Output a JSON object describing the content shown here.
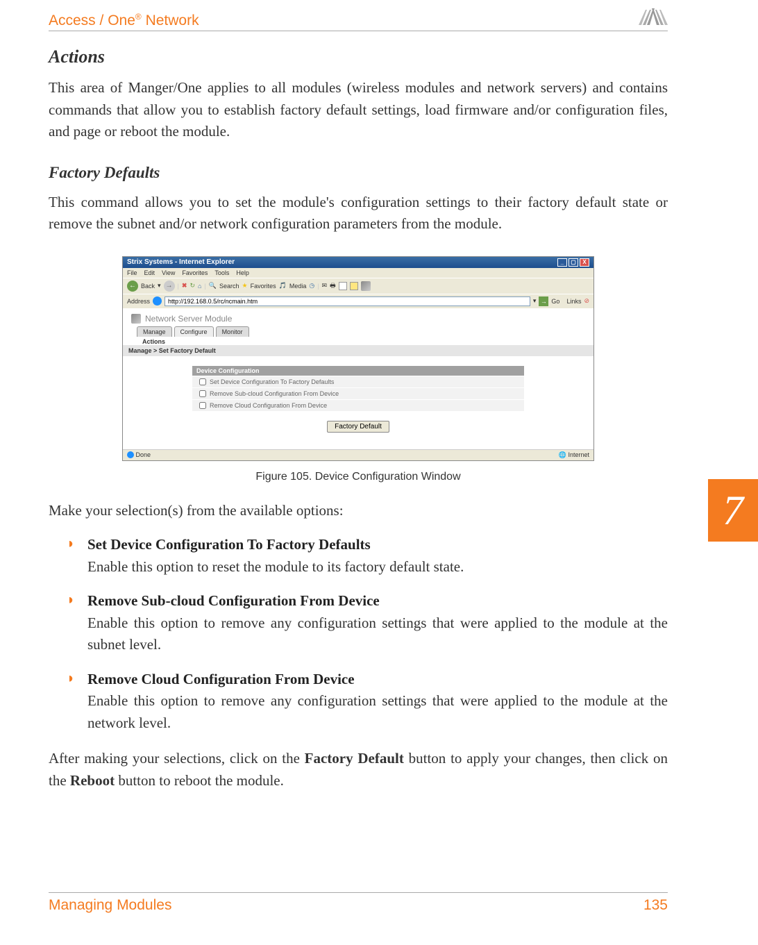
{
  "header": {
    "brand_prefix": "Access / One",
    "brand_suffix": " Network"
  },
  "sections": {
    "actions_title": "Actions",
    "actions_para": "This area of Manger/One applies to all modules (wireless modules and network servers) and contains commands that allow you to establish factory default settings, load firmware and/or configuration files, and page or reboot the module.",
    "factory_title": "Factory Defaults",
    "factory_para": "This command allows you to set the module's configuration settings to their factory default state or remove the subnet and/or network configuration parameters from the module."
  },
  "screenshot": {
    "window_title": "Strix Systems - Internet Explorer",
    "menu": {
      "file": "File",
      "edit": "Edit",
      "view": "View",
      "favorites": "Favorites",
      "tools": "Tools",
      "help": "Help"
    },
    "toolbar": {
      "back": "Back",
      "search": "Search",
      "favorites": "Favorites",
      "media": "Media"
    },
    "address_label": "Address",
    "url": "http://192.168.0.5/rc/ncmain.htm",
    "go": "Go",
    "links": "Links",
    "module_title": "Network Server Module",
    "tabs": {
      "manage": "Manage",
      "configure": "Configure",
      "monitor": "Monitor"
    },
    "actions_label": "Actions",
    "breadcrumb": "Manage > Set Factory Default",
    "config_header": "Device Configuration",
    "opt1": "Set Device Configuration To Factory Defaults",
    "opt2": "Remove Sub-cloud Configuration From Device",
    "opt3": "Remove Cloud Configuration From Device",
    "button": "Factory Default",
    "status_done": "Done",
    "status_internet": "Internet"
  },
  "figure_caption": "Figure 105. Device Configuration Window",
  "post_figure_para": "Make your selection(s) from the available options:",
  "options": {
    "opt1_title": "Set Device Configuration To Factory Defaults",
    "opt1_desc": "Enable this option to reset the module to its factory default state.",
    "opt2_title": "Remove Sub-cloud Configuration From Device",
    "opt2_desc": "Enable this option to remove any configuration settings that were applied to the module at the subnet level.",
    "opt3_title": "Remove Cloud Configuration From Device",
    "opt3_desc": "Enable this option to remove any configuration settings that were applied to the module at the network level."
  },
  "closing_para_pre": "After making your selections, click on the ",
  "closing_bold1": "Factory Default",
  "closing_mid": " button to apply your changes, then click on the ",
  "closing_bold2": "Reboot",
  "closing_post": " button to reboot the module.",
  "chapter_tab": "7",
  "footer": {
    "left": "Managing Modules",
    "right": "135"
  }
}
